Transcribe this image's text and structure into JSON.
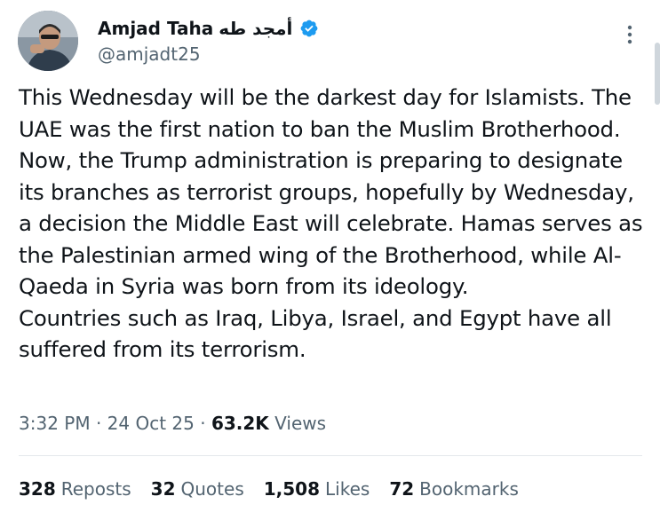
{
  "author": {
    "name": "Amjad Taha",
    "name_arabic": "أمجد طه",
    "handle": "@amjadt25",
    "verified": true,
    "verified_color": "#1d9bf0",
    "avatar_icon": "profile-photo"
  },
  "post": {
    "text": "This Wednesday will be the darkest day for Islamists. The UAE was the first nation to ban the Muslim Brotherhood. Now, the Trump administration is preparing to designate its branches as terrorist groups, hopefully by Wednesday, a decision the Middle East will celebrate. Hamas serves as the Palestinian armed wing of the Brotherhood, while Al-Qaeda in Syria was born from its ideology.\nCountries such as Iraq, Libya, Israel, and Egypt have all suffered from its terrorism.",
    "time": "3:32 PM",
    "separator": "·",
    "date": "24 Oct 25",
    "views_count": "63.2K",
    "views_label": "Views"
  },
  "stats": {
    "reposts": {
      "count": "328",
      "label": "Reposts"
    },
    "quotes": {
      "count": "32",
      "label": "Quotes"
    },
    "likes": {
      "count": "1,508",
      "label": "Likes"
    },
    "bookmarks": {
      "count": "72",
      "label": "Bookmarks"
    }
  },
  "icons": {
    "more": "more-vertical-icon",
    "verified": "verified-badge-icon"
  },
  "colors": {
    "text_primary": "#0f1419",
    "text_secondary": "#536471",
    "divider": "#e4e8eb"
  }
}
